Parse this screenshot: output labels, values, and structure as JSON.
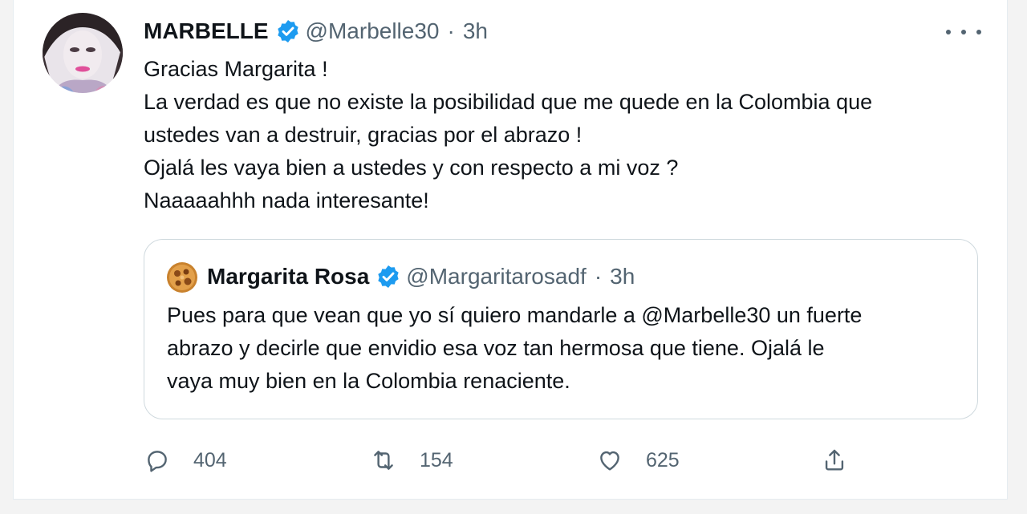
{
  "tweet": {
    "author_name": "MARBELLE",
    "handle": "@Marbelle30",
    "separator": "·",
    "time": "3h",
    "lines": [
      "Gracias Margarita !",
      "La verdad es que no existe la posibilidad que me quede en la Colombia que",
      "ustedes van a destruir, gracias por el abrazo !",
      "Ojalá les vaya bien a ustedes y con respecto a mi voz ?",
      "Naaaaahhh  nada interesante!"
    ]
  },
  "quoted": {
    "author_name": "Margarita Rosa",
    "handle": "@Margaritarosadf",
    "separator": "·",
    "time": "3h",
    "lines": [
      "Pues para que vean que yo sí quiero mandarle a @Marbelle30 un fuerte",
      "abrazo y decirle que envidio esa voz tan hermosa que tiene. Ojalá le",
      "vaya muy bien en la Colombia renaciente."
    ]
  },
  "actions": {
    "replies": "404",
    "retweets": "154",
    "likes": "625"
  },
  "colors": {
    "verified": "#1d9bf0",
    "muted": "#536471",
    "border": "#cfd9de"
  }
}
